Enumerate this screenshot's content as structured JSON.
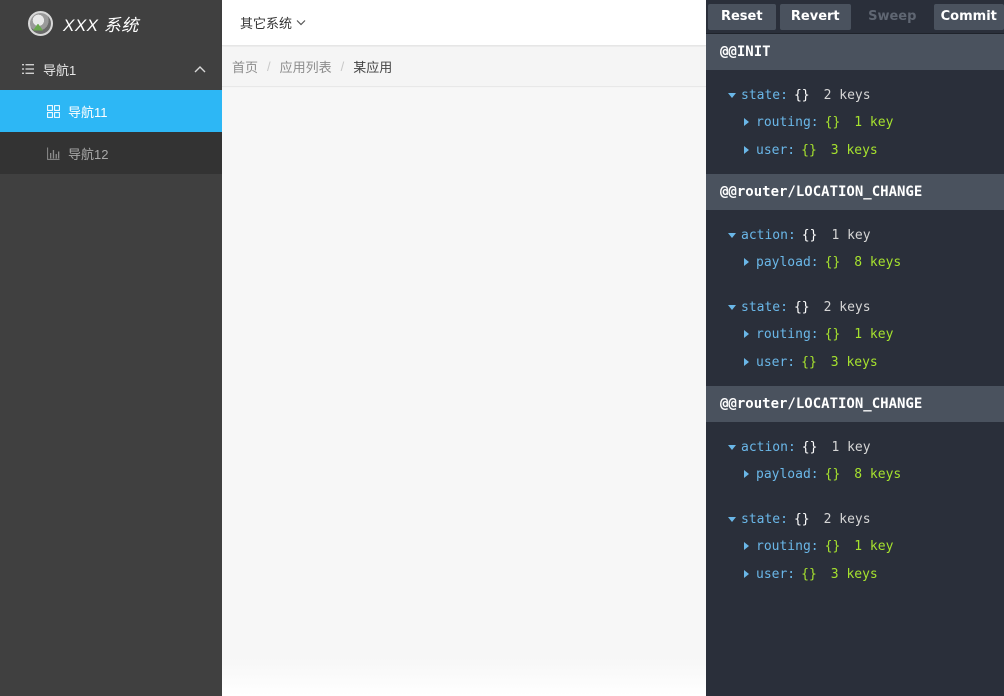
{
  "app": {
    "title": "XXX 系统"
  },
  "sidebar": {
    "group": {
      "label": "导航1",
      "icon": "list-icon",
      "expanded": true
    },
    "items": [
      {
        "label": "导航11",
        "icon": "grid-icon",
        "active": true
      },
      {
        "label": "导航12",
        "icon": "bar-chart-icon",
        "active": false
      }
    ]
  },
  "topbar": {
    "system_select": "其它系统"
  },
  "breadcrumb": {
    "items": [
      "首页",
      "应用列表",
      "某应用"
    ],
    "separator": "/"
  },
  "devtools": {
    "buttons": {
      "reset": "Reset",
      "revert": "Revert",
      "sweep": "Sweep",
      "commit": "Commit"
    },
    "actions": [
      {
        "title": "@@INIT",
        "groups": [
          {
            "key": "state:",
            "brace": "{}",
            "count": "2 keys",
            "children": [
              {
                "key": "routing:",
                "brace": "{}",
                "count": "1 key"
              },
              {
                "key": "user:",
                "brace": "{}",
                "count": "3 keys"
              }
            ]
          }
        ]
      },
      {
        "title": "@@router/LOCATION_CHANGE",
        "groups": [
          {
            "key": "action:",
            "brace": "{}",
            "count": "1 key",
            "children": [
              {
                "key": "payload:",
                "brace": "{}",
                "count": "8 keys"
              }
            ]
          },
          {
            "key": "state:",
            "brace": "{}",
            "count": "2 keys",
            "children": [
              {
                "key": "routing:",
                "brace": "{}",
                "count": "1 key"
              },
              {
                "key": "user:",
                "brace": "{}",
                "count": "3 keys"
              }
            ]
          }
        ]
      },
      {
        "title": "@@router/LOCATION_CHANGE",
        "groups": [
          {
            "key": "action:",
            "brace": "{}",
            "count": "1 key",
            "children": [
              {
                "key": "payload:",
                "brace": "{}",
                "count": "8 keys"
              }
            ]
          },
          {
            "key": "state:",
            "brace": "{}",
            "count": "2 keys",
            "children": [
              {
                "key": "routing:",
                "brace": "{}",
                "count": "1 key"
              },
              {
                "key": "user:",
                "brace": "{}",
                "count": "3 keys"
              }
            ]
          }
        ]
      }
    ]
  },
  "colors": {
    "sidebar_bg": "#404040",
    "active_item": "#2db7f5",
    "devtools_bg": "#2a2f3a",
    "key_blue": "#6ab7e8",
    "value_green": "#a6e22e"
  }
}
